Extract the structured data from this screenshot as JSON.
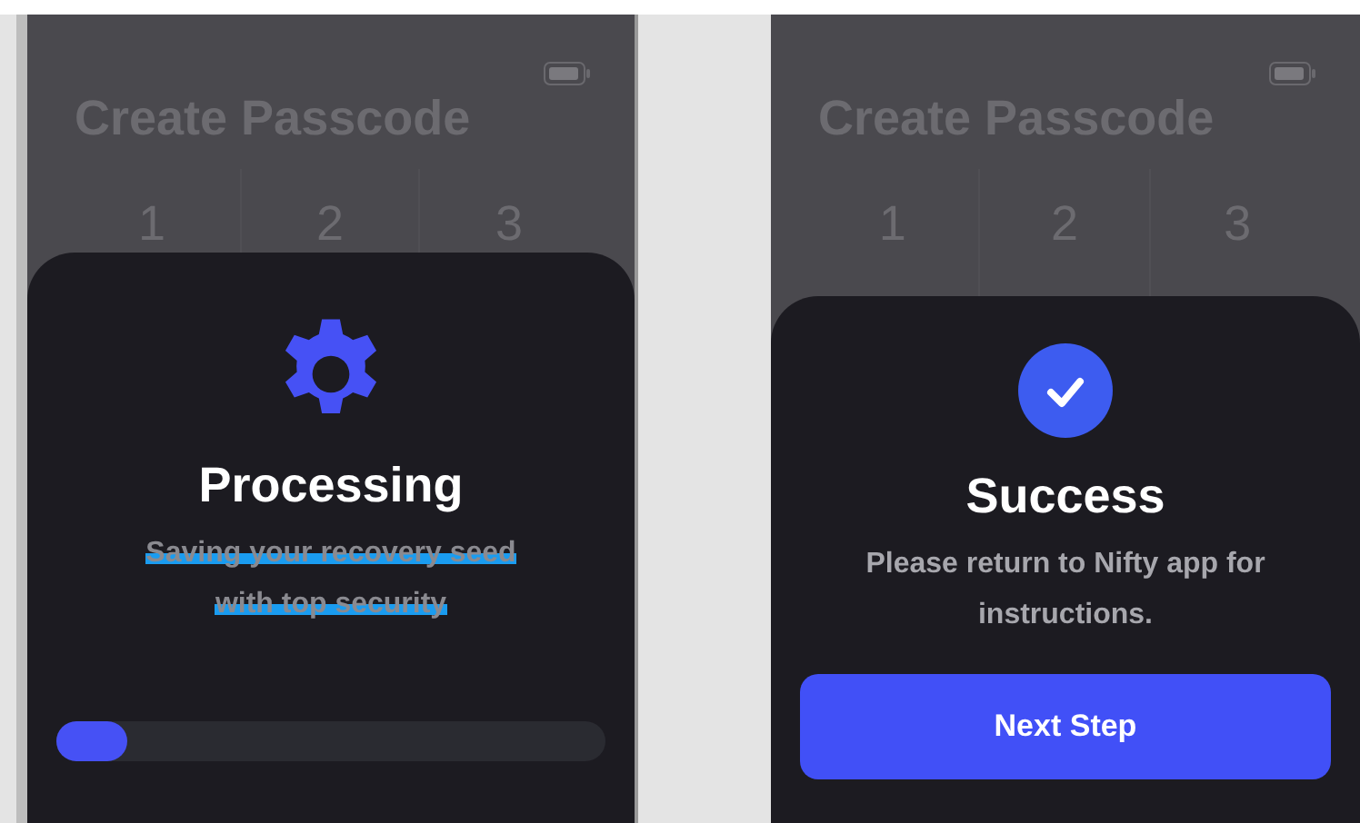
{
  "screens": [
    {
      "kind": "processing",
      "title": "Create Passcode",
      "keys": [
        "1",
        "2",
        "3"
      ],
      "sheet": {
        "heading": "Processing",
        "message": "Saving your recovery seed with top security",
        "redacted": true,
        "progress": {
          "level": 0.13
        }
      }
    },
    {
      "kind": "success",
      "title": "Create Passcode",
      "keys": [
        "1",
        "2",
        "3"
      ],
      "sheet": {
        "heading": "Success",
        "message": "Please return to Nifty app for instructions.",
        "button": "Next Step"
      }
    }
  ]
}
